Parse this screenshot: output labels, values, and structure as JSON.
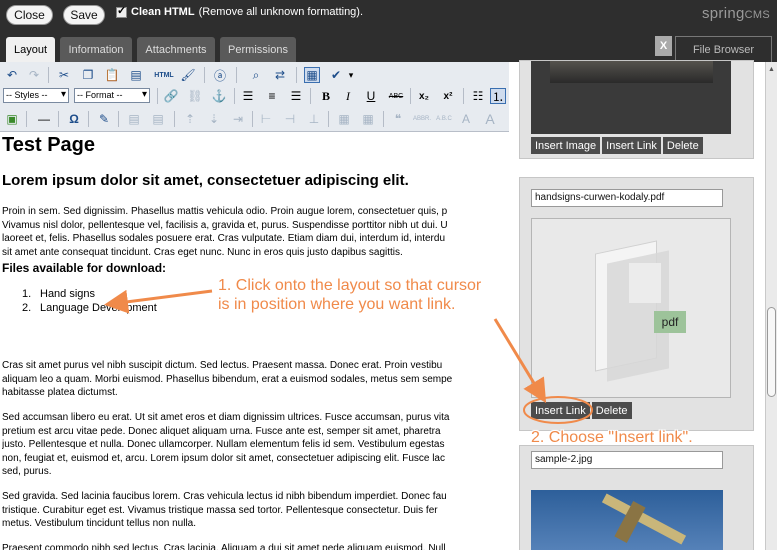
{
  "topbar": {
    "close_label": "Close",
    "save_label": "Save",
    "clean_html_label": "Clean HTML",
    "clean_html_note": "(Remove all unknown formatting).",
    "logo_main": "spring",
    "logo_suffix": "CMS"
  },
  "tabs": [
    {
      "label": "Layout",
      "active": true
    },
    {
      "label": "Information",
      "active": false
    },
    {
      "label": "Attachments",
      "active": false
    },
    {
      "label": "Permissions",
      "active": false
    }
  ],
  "file_browser": {
    "close_label": "X",
    "tab_label": "File Browser"
  },
  "toolbar": {
    "styles_select": "-- Styles --",
    "format_select": "-- Format --",
    "html_label": "HTML",
    "bold_label": "B",
    "italic_label": "I",
    "underline_label": "U",
    "strike_label": "ABC",
    "sub_label": "x₂",
    "sup_label": "x²",
    "omega_label": "Ω"
  },
  "content": {
    "title": "Test Page",
    "heading": "Lorem ipsum dolor sit amet, consectetuer adipiscing elit.",
    "para1": [
      "Proin in sem. Sed dignissim. Phasellus mattis vehicula odio. Proin augue lorem, consectetuer quis, p",
      "Vivamus nisl dolor, pellentesque vel, facilisis a, gravida et, purus. Suspendisse porttitor nibh ut dui. U",
      "laoreet et, felis. Phasellus sodales posuere erat. Cras vulputate. Etiam diam dui, interdum id, interdu",
      "sit amet ante consequat tincidunt. Cras eget nunc. Nunc in eros quis justo dapibus sagittis."
    ],
    "files_heading": "Files available for download:",
    "files": [
      "Hand signs",
      "Language Development"
    ],
    "para2": [
      "Cras sit amet purus vel nibh suscipit dictum. Sed lectus. Praesent massa. Donec erat. Proin vestibu",
      "aliquam leo a quam. Morbi euismod. Phasellus bibendum, erat a euismod sodales, metus sem sempe",
      "habitasse platea dictumst."
    ],
    "para3": [
      "Sed accumsan libero eu erat. Ut sit amet eros et diam dignissim ultrices. Fusce accumsan, purus vita",
      "pretium est arcu vitae pede. Donec aliquet aliquam urna. Fusce ante est, semper sit amet, pharetra",
      "justo. Pellentesque et nulla. Donec ullamcorper. Nullam elementum felis id sem. Vestibulum egestas",
      "non, feugiat et, euismod et, arcu. Lorem ipsum dolor sit amet, consectetuer adipiscing elit. Fusce lac",
      "sed, purus."
    ],
    "para4": [
      "Sed gravida. Sed lacinia faucibus lorem. Cras vehicula lectus id nibh bibendum imperdiet. Donec fau",
      "tristique. Curabitur eget est. Vivamus tristique massa sed tortor. Pellentesque consectetur. Duis fer",
      "metus. Vestibulum tincidunt tellus non nulla."
    ],
    "para5": [
      "Praesent commodo nibh sed lectus. Cras lacinia. Aliquam a dui sit amet pede aliquam euismod. Null"
    ]
  },
  "file_panel": {
    "card1": {
      "insert_image": "Insert Image",
      "insert_link": "Insert Link",
      "delete": "Delete"
    },
    "card2": {
      "filename": "handsigns-curwen-kodaly.pdf",
      "type_badge": "pdf",
      "insert_link": "Insert Link",
      "delete": "Delete"
    },
    "card3": {
      "filename": "sample-2.jpg"
    }
  },
  "annotations": {
    "step1_line1": "1. Click onto the layout so that cursor",
    "step1_line2": "is in position where you want link.",
    "step2": "2. Choose \"Insert link\"."
  },
  "colors": {
    "accent_orange": "#f08a4a",
    "dark_bar": "#2e2e2e"
  }
}
